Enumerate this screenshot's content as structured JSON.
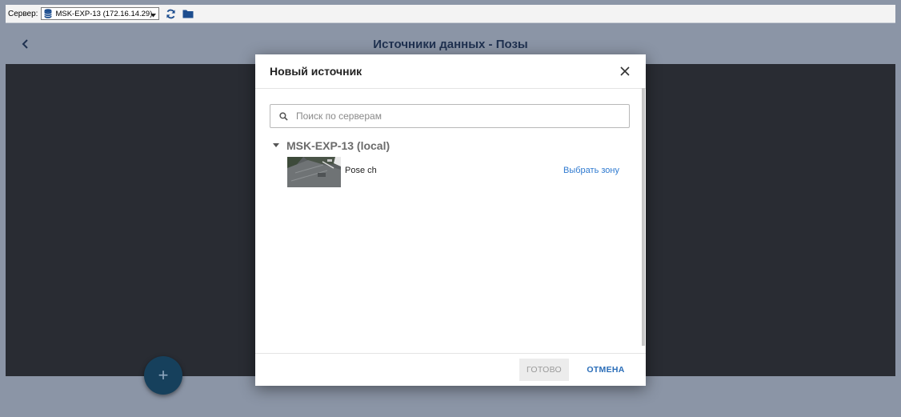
{
  "toolbar": {
    "server_label": "Сервер:",
    "server_value": "MSK-EXP-13 (172.16.14.29)",
    "icons": [
      "database-icon",
      "dropdown-caret-icon",
      "refresh-icon",
      "folder-icon"
    ]
  },
  "page": {
    "title": "Источники данных - Позы",
    "fab_label": "+",
    "colors": {
      "header": "#8b95a6",
      "content": "#292c33",
      "fab": "#16405c"
    }
  },
  "modal": {
    "title": "Новый источник",
    "search_placeholder": "Поиск по серверам",
    "server_name": "MSK-EXP-13 (local)",
    "camera_name": "Pose ch",
    "select_zone_label": "Выбрать зону",
    "done_label": "ГОТОВО",
    "cancel_label": "ОТМЕНА",
    "accent_color": "#2f7ad0"
  }
}
